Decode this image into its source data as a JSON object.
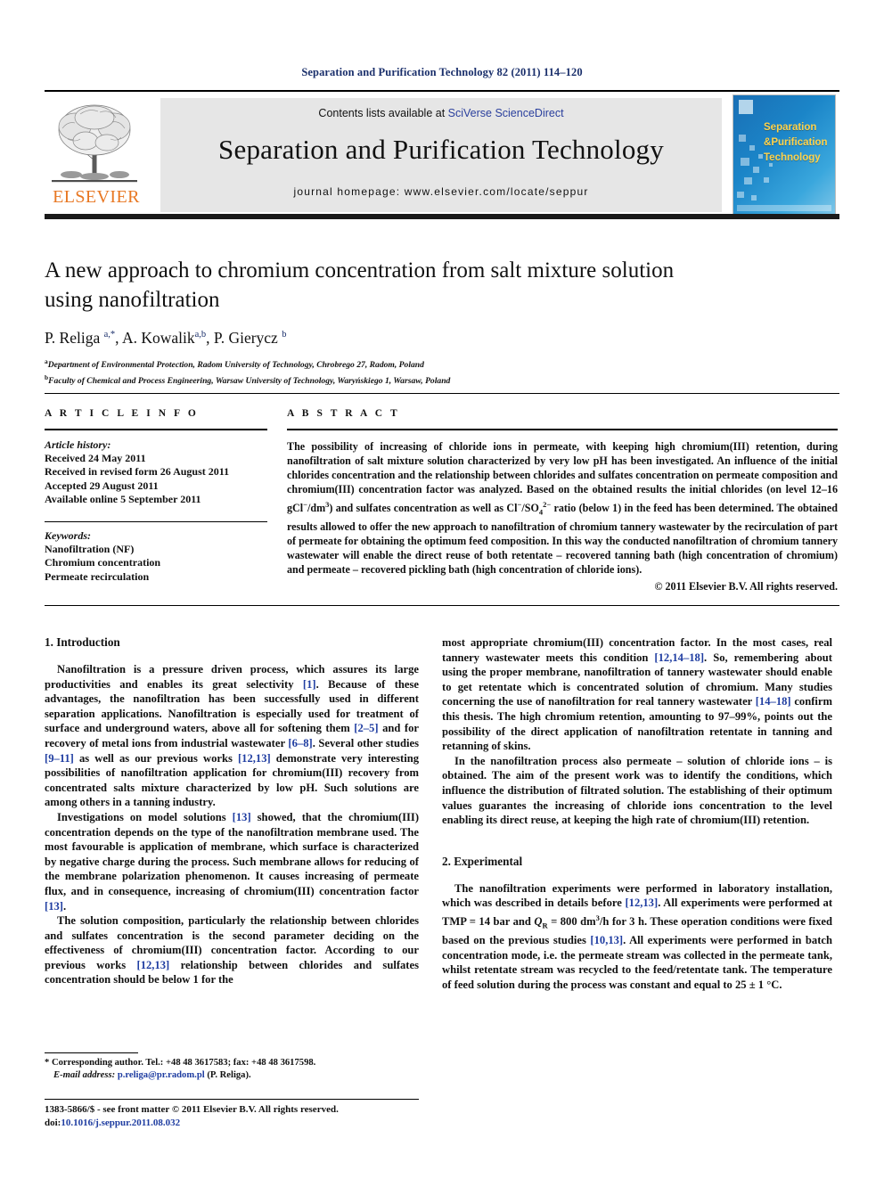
{
  "running_head": "Separation and Purification Technology 82 (2011) 114–120",
  "masthead": {
    "contents_prefix": "Contents lists available at ",
    "contents_link": "SciVerse ScienceDirect",
    "journal_title": "Separation and Purification Technology",
    "homepage": "journal homepage: www.elsevier.com/locate/seppur",
    "publisher_wordmark": "ELSEVIER",
    "cover_title_line1": "Separation",
    "cover_title_line2": "Purification",
    "cover_title_line3": "Technology",
    "cover_amp": "&",
    "accent_orange": "#E87722",
    "accent_blue": "#2a3f9d",
    "cover_blue": "#1b85c8",
    "cover_yellow": "#ffd24a"
  },
  "article": {
    "title_line1": "A new approach to chromium concentration from salt mixture solution",
    "title_line2": "using nanofiltration",
    "authors": [
      {
        "name": "P. Religa ",
        "sup": "a,*",
        "sep": ", "
      },
      {
        "name": "A. Kowalik",
        "sup": "a,b",
        "sep": ", "
      },
      {
        "name": "P. Gierycz ",
        "sup": "b",
        "sep": ""
      }
    ],
    "affiliations": [
      {
        "mark": "a",
        "text": "Department of Environmental Protection, Radom University of Technology, Chrobrego 27, Radom, Poland"
      },
      {
        "mark": "b",
        "text": "Faculty of Chemical and Process Engineering, Warsaw University of Technology, Waryńskiego 1, Warsaw, Poland"
      }
    ]
  },
  "info": {
    "heading": "A R T I C L E   I N F O",
    "history_head": "Article history:",
    "history": [
      "Received 24 May 2011",
      "Received in revised form 26 August 2011",
      "Accepted 29 August 2011",
      "Available online 5 September 2011"
    ],
    "keywords_head": "Keywords:",
    "keywords": [
      "Nanofiltration (NF)",
      "Chromium concentration",
      "Permeate recirculation"
    ]
  },
  "abstract": {
    "heading": "A B S T R A C T",
    "part1": "The possibility of increasing of chloride ions in permeate, with keeping high chromium(III) retention, during nanofiltration of salt mixture solution characterized by very low pH has been investigated. An influence of the initial chlorides concentration and the relationship between chlorides and sulfates concentration on permeate composition and chromium(III) concentration factor was analyzed. Based on the obtained results the initial chlorides (on level 12–16 gCl",
    "sup1": "−",
    "part2": "/dm",
    "sup2": "3",
    "part3": ") and sulfates concentration as well as Cl",
    "sup3": "−",
    "part4": "/SO",
    "sub1": "4",
    "sup4": "2−",
    "part5": " ratio (below 1) in the feed has been determined. The obtained results allowed to offer the new approach to nanofiltration of chromium tannery wastewater by the recirculation of part of permeate for obtaining the optimum feed composition. In this way the conducted nanofiltration of chromium tannery wastewater will enable the direct reuse of both retentate – recovered tanning bath (high concentration of chromium) and permeate – recovered pickling bath (high concentration of chloride ions).",
    "copyright": "© 2011 Elsevier B.V. All rights reserved."
  },
  "sections": {
    "introduction_heading": "1. Introduction",
    "experimental_heading": "2. Experimental"
  },
  "body_left": {
    "p1_a": "Nanofiltration is a pressure driven process, which assures its large productivities and enables its great selectivity ",
    "p1_r1": "[1]",
    "p1_b": ". Because of these advantages, the nanofiltration has been successfully used in different separation applications. Nanofiltration is especially used for treatment of surface and underground waters, above all for softening them ",
    "p1_r2": "[2–5]",
    "p1_c": " and for recovery of metal ions from industrial wastewater ",
    "p1_r3": "[6–8]",
    "p1_d": ". Several other studies ",
    "p1_r4": "[9–11]",
    "p1_e": " as well as our previous works ",
    "p1_r5": "[12,13]",
    "p1_f": " demonstrate very interesting possibilities of nanofiltration application for chromium(III) recovery from concentrated salts mixture characterized by low pH. Such solutions are among others in a tanning industry.",
    "p2_a": "Investigations on model solutions ",
    "p2_r1": "[13]",
    "p2_b": " showed, that the chromium(III) concentration depends on the type of the nanofiltration membrane used. The most favourable is application of membrane, which surface is characterized by negative charge during the process. Such membrane allows for reducing of the membrane polarization phenomenon. It causes increasing of permeate flux, and in consequence, increasing of chromium(III) concentration factor ",
    "p2_r2": "[13]",
    "p2_c": ".",
    "p3_a": "The solution composition, particularly the relationship between chlorides and sulfates concentration is the second parameter deciding on the effectiveness of chromium(III) concentration factor. According to our previous works ",
    "p3_r1": "[12,13]",
    "p3_b": " relationship between chlorides and sulfates concentration should be below 1 for the"
  },
  "body_right": {
    "p1_a": "most appropriate chromium(III) concentration factor. In the most cases, real tannery wastewater meets this condition ",
    "p1_r1": "[12,14–18]",
    "p1_b": ". So, remembering about using the proper membrane, nanofiltration of tannery wastewater should enable to get retentate which is concentrated solution of chromium. Many studies concerning the use of nanofiltration for real tannery wastewater ",
    "p1_r2": "[14–18]",
    "p1_c": " confirm this thesis. The high chromium retention, amounting to 97–99%, points out the possibility of the direct application of nanofiltration retentate in tanning and retanning of skins.",
    "p2": "In the nanofiltration process also permeate – solution of chloride ions – is obtained. The aim of the present work was to identify the conditions, which influence the distribution of filtrated solution. The establishing of their optimum values guarantes the increasing of chloride ions concentration to the level enabling its direct reuse, at keeping the high rate of chromium(III) retention.",
    "p3_a": "The nanofiltration experiments were performed in laboratory installation, which was described in details before ",
    "p3_r1": "[12,13]",
    "p3_b": ". All experiments were performed at TMP = 14 bar and ",
    "p3_q": "Q",
    "p3_qsub": "R",
    "p3_c": " = 800 dm",
    "p3_sup": "3",
    "p3_d": "/h for 3 h. These operation conditions were fixed based on the previous studies ",
    "p3_r2": "[10,13]",
    "p3_e": ". All experiments were performed in batch concentration mode, i.e. the permeate stream was collected in the permeate tank, whilst retentate stream was recycled to the feed/retentate tank. The temperature of feed solution during the process was constant and equal to 25 ± 1 ",
    "p3_temp": "°C",
    "p3_f": "."
  },
  "footnotes": {
    "corresponding": "* Corresponding author. Tel.: +48 48 3617583; fax: +48 48 3617598.",
    "email_label": "E-mail address:",
    "email": "p.religa@pr.radom.pl",
    "email_owner": "(P. Religa).",
    "imprint": "1383-5866/$ - see front matter © 2011 Elsevier B.V. All rights reserved.",
    "doi_label": "doi:",
    "doi": "10.1016/j.seppur.2011.08.032"
  }
}
